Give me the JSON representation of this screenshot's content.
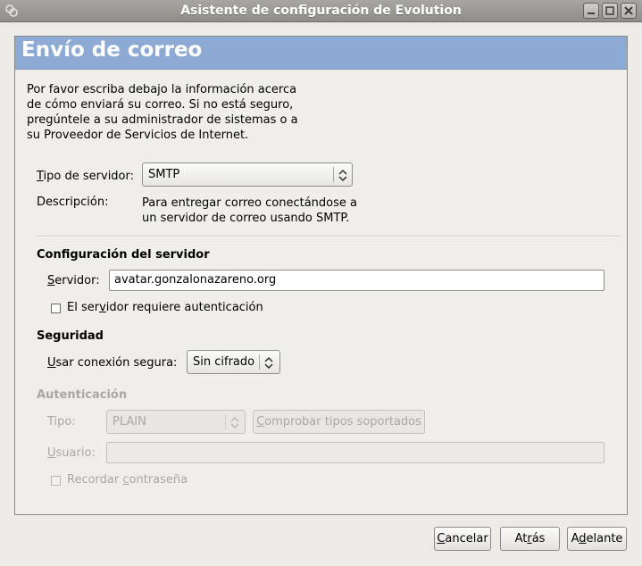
{
  "window": {
    "title": "Asistente de configuración de Evolution"
  },
  "header": {
    "title": "Envío de correo"
  },
  "intro": "Por favor escriba debajo la información acerca\nde cómo enviará su correo. Si no está seguro,\npregúntele a su administrador de sistemas o a\nsu Proveedor de Servicios de Internet.",
  "server_type": {
    "label_mnemonic": "T",
    "label_rest": "ipo de servidor:",
    "value": "SMTP",
    "description_label": "Descripción:",
    "description": "Para entregar correo conectándose a\nun servidor de correo usando SMTP."
  },
  "server_config": {
    "heading": "Configuración del servidor",
    "server_label_mnemonic": "S",
    "server_label_rest": "ervidor:",
    "server_value": "avatar.gonzalonazareno.org",
    "auth_required_label_pre": "El ser",
    "auth_required_mnemonic": "v",
    "auth_required_label_post": "idor requiere autenticación",
    "auth_required_checked": false
  },
  "security": {
    "heading": "Seguridad",
    "label_mnemonic": "U",
    "label_rest": "sar conexión segura:",
    "value": "Sin cifrado"
  },
  "authentication": {
    "heading": "Autenticación",
    "type_label": "Tipo:",
    "type_value": "PLAIN",
    "check_button_mnemonic": "C",
    "check_button_rest": "omprobar tipos soportados",
    "user_label_mnemonic": "U",
    "user_label_rest": "suario:",
    "user_value": "",
    "remember_label_pre": "Recordar ",
    "remember_mnemonic": "c",
    "remember_label_post": "ontraseña",
    "remember_checked": false
  },
  "buttons": {
    "cancel_mnemonic": "C",
    "cancel_rest": "ancelar",
    "back_pre": "At",
    "back_mnemonic": "r",
    "back_post": "ás",
    "forward_pre": "A",
    "forward_mnemonic": "d",
    "forward_post": "elante"
  }
}
